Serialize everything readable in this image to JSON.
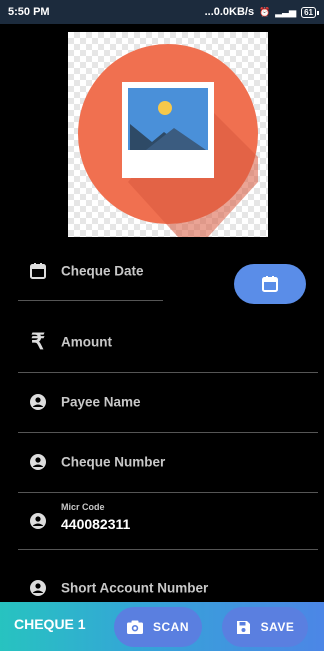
{
  "status_bar": {
    "time": "5:50 PM",
    "network_speed": "...0.0KB/s",
    "battery": "61"
  },
  "image": {
    "icon": "image-placeholder-icon",
    "circle_color": "#f07050"
  },
  "form": {
    "cheque_date_label": "Cheque Date",
    "amount_label": "Amount",
    "payee_name_label": "Payee Name",
    "cheque_number_label": "Cheque Number",
    "micr_code_label": "Micr Code",
    "micr_code_value": "440082311",
    "short_account_label": "Short Account Number"
  },
  "bottom_bar": {
    "cheque_label": "CHEQUE 1",
    "scan_label": "SCAN",
    "save_label": "SAVE"
  },
  "colors": {
    "accent": "#5a8de8",
    "bar_gradient_start": "#27c3c0",
    "bar_gradient_end": "#4c86e6"
  }
}
